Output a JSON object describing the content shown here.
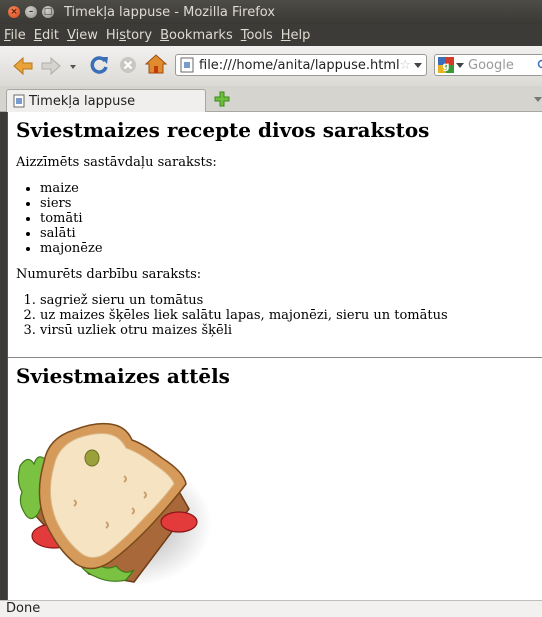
{
  "window": {
    "title": "Timekļa lappuse - Mozilla Firefox"
  },
  "menu": [
    {
      "u": "F",
      "rest": "ile"
    },
    {
      "u": "E",
      "rest": "dit"
    },
    {
      "u": "V",
      "rest": "iew"
    },
    {
      "pre": "Hi",
      "u": "s",
      "rest": "tory"
    },
    {
      "u": "B",
      "rest": "ookmarks"
    },
    {
      "u": "T",
      "rest": "ools"
    },
    {
      "u": "H",
      "rest": "elp"
    }
  ],
  "navbar": {
    "url": "file:///home/anita/lappuse.html",
    "search_placeholder": "Google"
  },
  "tab": {
    "label": "Timekļa lappuse"
  },
  "page": {
    "h1": "Sviestmaizes recepte divos sarakstos",
    "ul_intro": "Aizzīmēts sastāvdaļu saraksts:",
    "ingredients": [
      "maize",
      "siers",
      "tomāti",
      "salāti",
      "majonēze"
    ],
    "ol_intro": "Numurēts darbību saraksts:",
    "steps": [
      "sagriež sieru un tomātus",
      "uz maizes šķēles liek salātu lapas, majonēzi, sieru un tomātus",
      "virsū uzliek otru maizes šķēli"
    ],
    "h2": "Sviestmaizes attēls"
  },
  "status": {
    "text": "Done"
  },
  "colors": {
    "close_button": "#d6461c",
    "firefox_orange": "#e66000",
    "link_blue": "#3a6fb7"
  }
}
